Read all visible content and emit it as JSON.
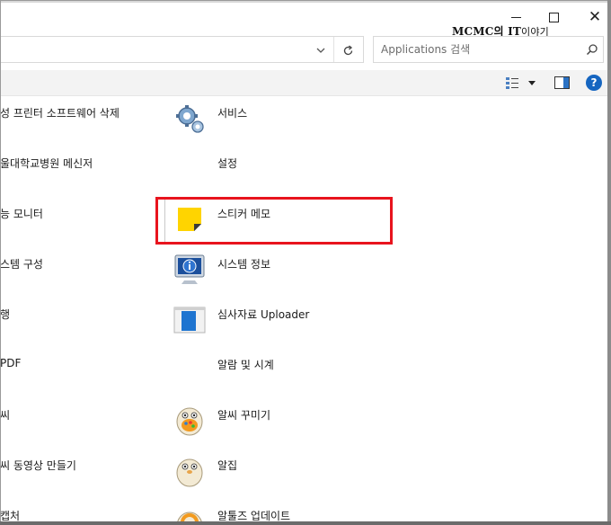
{
  "window": {
    "minimize_icon": "minimize-icon",
    "maximize_icon": "maximize-icon",
    "close_icon": "close-icon",
    "watermark": {
      "bold": "MCMC의 IT",
      "rest": "이야기"
    }
  },
  "address": {
    "dropdown_icon": "chevron-down-icon",
    "refresh_icon": "refresh-icon"
  },
  "search": {
    "placeholder": "Applications 검색",
    "icon": "search-icon"
  },
  "toolbar": {
    "view_icon": "view-options-icon",
    "view_dropdown_icon": "chevron-down-icon",
    "pane_icon": "preview-pane-icon",
    "help_label": "?"
  },
  "left_column": [
    "성 프린터 소프트웨어 삭제",
    "울대학교병원 메신저",
    "능 모니터",
    "스템 구성",
    "행",
    "PDF",
    "씨",
    "씨 동영상 만들기",
    "캡처"
  ],
  "right_column": [
    {
      "label": "서비스",
      "icon": "gears-icon"
    },
    {
      "label": "설정",
      "icon": "none"
    },
    {
      "label": "스티커 메모",
      "icon": "sticky-notes-icon"
    },
    {
      "label": "시스템 정보",
      "icon": "system-info-icon"
    },
    {
      "label": "심사자료 Uploader",
      "icon": "uploader-icon"
    },
    {
      "label": "알람 및 시계",
      "icon": "none"
    },
    {
      "label": "알씨 꾸미기",
      "icon": "alsee-decorate-icon"
    },
    {
      "label": "알집",
      "icon": "alzip-icon"
    },
    {
      "label": "알툴즈 업데이트",
      "icon": "altools-update-icon"
    }
  ],
  "colors": {
    "highlight": "#e8141e",
    "help": "#1565c0",
    "toolbar_bg": "#f3f3f3"
  }
}
